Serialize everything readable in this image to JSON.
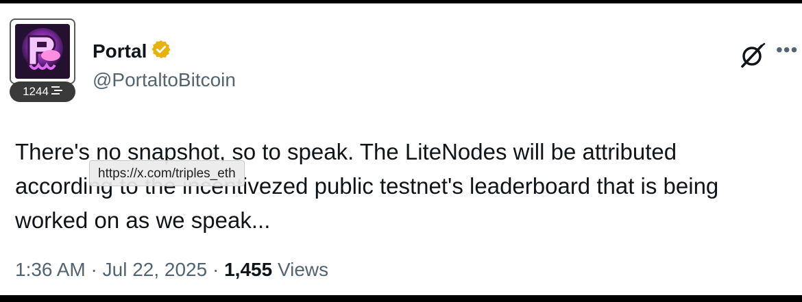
{
  "author": {
    "display_name": "Portal",
    "handle": "@PortaltoBitcoin",
    "verified_badge_color": "#e8b20c",
    "level": "1244"
  },
  "tweet": {
    "lines": [
      "There's no snapshot, so to speak. The LiteNodes will be attributed",
      "according to the incentivezed public testnet's leaderboard that is being",
      "worked on as we speak..."
    ],
    "link_tooltip": "https://x.com/triples_eth"
  },
  "meta": {
    "time": "1:36 AM",
    "separator": "·",
    "date": "Jul 22, 2025",
    "views_count": "1,455",
    "views_label": "Views"
  },
  "icons": {
    "grok": "grok-icon",
    "more": "more-icon",
    "verified": "verified-badge-icon",
    "level": "list-lines-icon"
  },
  "colors": {
    "text_primary": "#0f1419",
    "text_secondary": "#536471",
    "avatar_accent": "#c04ad8"
  }
}
